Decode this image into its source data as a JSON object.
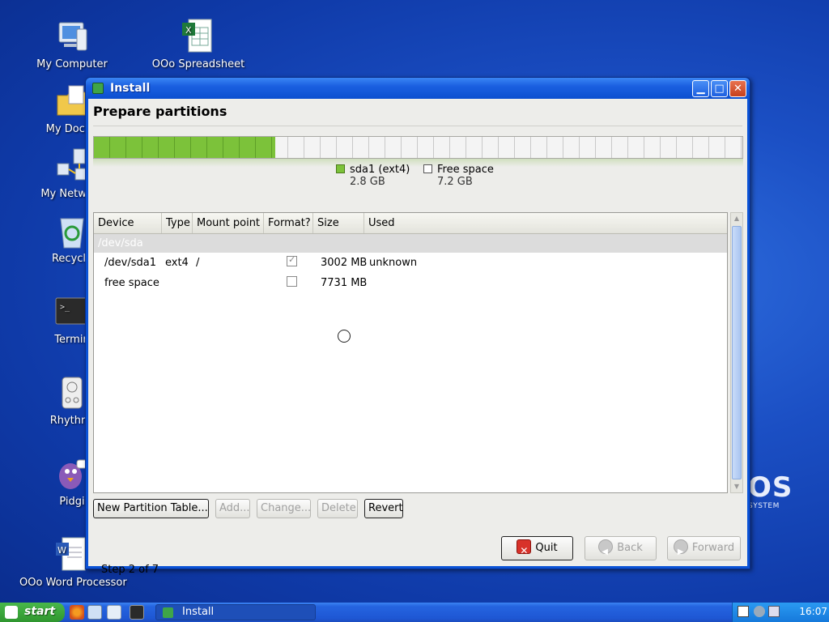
{
  "desktop": {
    "icons": [
      {
        "label": "My Computer"
      },
      {
        "label": "OOo Spreadsheet"
      },
      {
        "label": "My Docun"
      },
      {
        "label": "My Network"
      },
      {
        "label": "Recycle"
      },
      {
        "label": "Termin"
      },
      {
        "label": "Rhythml"
      },
      {
        "label": "Pidgi"
      },
      {
        "label": "OOo Word Processor"
      }
    ],
    "brand_text": "OS",
    "brand_subtext": "SYSTEM"
  },
  "window": {
    "title": "Install",
    "heading": "Prepare partitions",
    "partition_bar": {
      "used_fraction": 0.28,
      "used_color": "#7cc23a"
    },
    "legend": [
      {
        "name": "sda1 (ext4)",
        "size": "2.8 GB",
        "color": "#7cc23a"
      },
      {
        "name": "Free space",
        "size": "7.2 GB",
        "color": "#ffffff"
      }
    ],
    "table": {
      "headers": [
        "Device",
        "Type",
        "Mount point",
        "Format?",
        "Size",
        "Used"
      ],
      "group": "/dev/sda",
      "rows": [
        {
          "device": "/dev/sda1",
          "type": "ext4",
          "mount": "/",
          "format": true,
          "size": "3002 MB",
          "used": "unknown"
        },
        {
          "device": "free space",
          "type": "",
          "mount": "",
          "format": false,
          "size": "7731 MB",
          "used": ""
        }
      ]
    },
    "buttons": {
      "new_table": "New Partition Table...",
      "add": "Add...",
      "change": "Change...",
      "delete": "Delete",
      "revert": "Revert",
      "quit": "Quit",
      "back": "Back",
      "forward": "Forward"
    },
    "step": "Step 2 of 7"
  },
  "taskbar": {
    "start_label": "start",
    "task_label": "Install",
    "clock": "16:07"
  },
  "colors": {
    "accent": "#0a52d6",
    "start_green": "#3a9f3a"
  }
}
